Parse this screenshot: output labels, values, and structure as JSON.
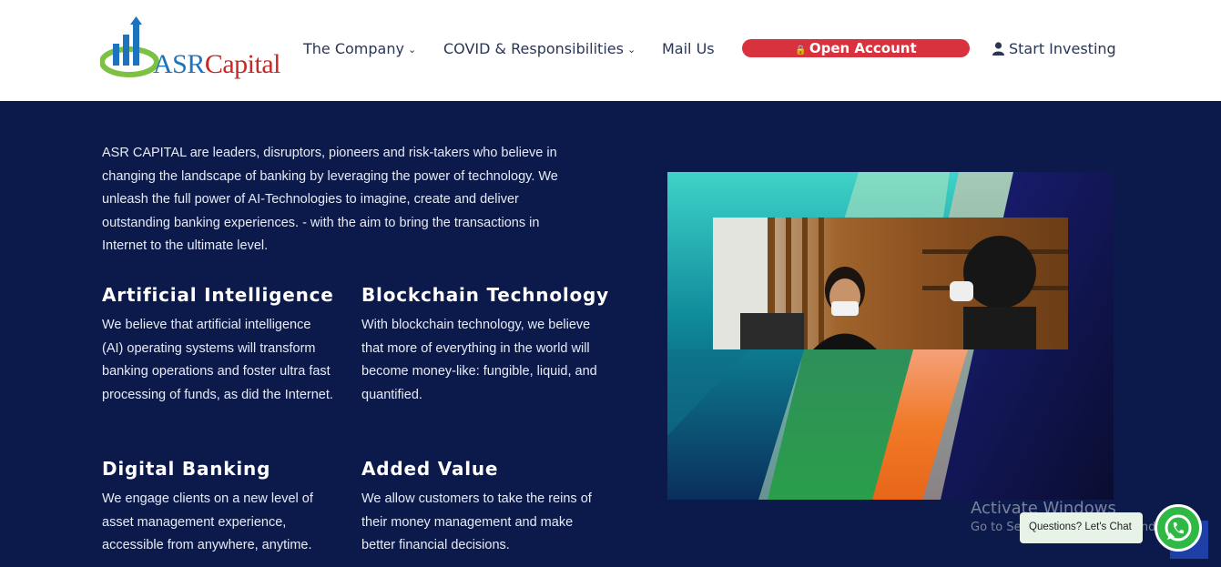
{
  "header": {
    "logo": {
      "text_asr": "ASR",
      "text_capital": "Capital"
    },
    "nav": [
      {
        "label": "The Company",
        "chevron": "chevron-down-icon"
      },
      {
        "label": "COVID & Responsibilities",
        "chevron": "chevron-down-icon"
      },
      {
        "label": "Mail Us"
      }
    ],
    "open_account_label": "Open Account",
    "open_account_icon": "lock-icon",
    "start_investing_label": "Start Investing",
    "start_investing_icon": "user-icon"
  },
  "main": {
    "intro": "ASR CAPITAL are leaders, disruptors, pioneers and risk-takers who believe in changing the landscape of banking by leveraging the power of technology. We unleash the full power of AI-Technologies to imagine, create and deliver outstanding banking experiences. - with the aim to bring the transactions in Internet to the ultimate level.",
    "features": [
      {
        "title": "Artificial Intelligence",
        "text": "We believe that artificial intelligence (AI) operating systems  will transform banking operations and foster ultra fast processing of funds, as did the Internet."
      },
      {
        "title": "Blockchain Technology",
        "text": "With blockchain technology, we believe that more of everything in the world will become money-like: fungible, liquid, and quantified."
      },
      {
        "title": "Digital Banking",
        "text": "We engage clients on a new level of asset management experience, accessible from anywhere, anytime."
      },
      {
        "title": "Added Value",
        "text": "We allow customers to take the reins of their money management and make better financial decisions."
      }
    ]
  },
  "overlay": {
    "activate_title": "Activate Windows",
    "activate_sub": "Go to Settings to activate Windows.",
    "chat_label": "Questions? Let's Chat",
    "whatsapp_icon": "whatsapp-icon",
    "scroll_top_icon": "arrow-up-icon"
  },
  "colors": {
    "navy": "#0b1a4a",
    "brand_red": "#d9323f",
    "nav_text": "#2b3655",
    "logo_green": "#7cc142",
    "logo_blue": "#1e73be"
  }
}
